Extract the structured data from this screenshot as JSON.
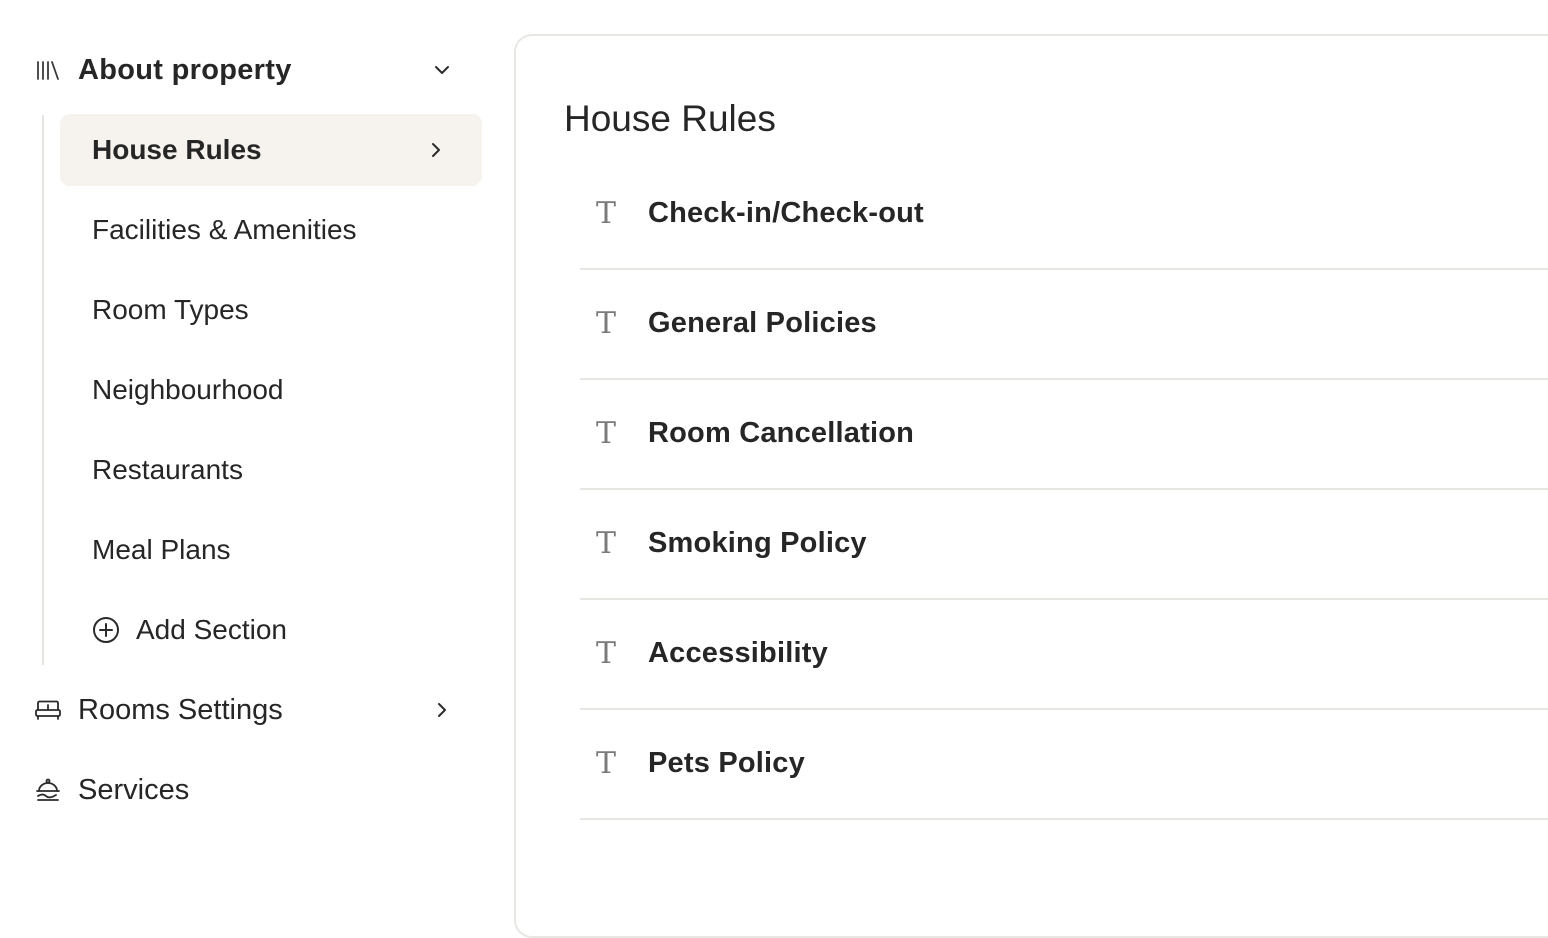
{
  "sidebar": {
    "group": {
      "label": "About property",
      "icon": "library-icon",
      "expanded": true
    },
    "sub_items": [
      {
        "label": "House Rules",
        "active": true
      },
      {
        "label": "Facilities & Amenities",
        "active": false
      },
      {
        "label": "Room Types",
        "active": false
      },
      {
        "label": "Neighbourhood",
        "active": false
      },
      {
        "label": "Restaurants",
        "active": false
      },
      {
        "label": "Meal Plans",
        "active": false
      }
    ],
    "add_section_label": "Add Section",
    "rooms_settings_label": "Rooms Settings",
    "services_label": "Services"
  },
  "main": {
    "title": "House Rules",
    "rules": [
      {
        "label": "Check-in/Check-out",
        "icon_glyph": "T"
      },
      {
        "label": "General Policies",
        "icon_glyph": "T"
      },
      {
        "label": "Room Cancellation",
        "icon_glyph": "T"
      },
      {
        "label": "Smoking Policy",
        "icon_glyph": "T"
      },
      {
        "label": "Accessibility",
        "icon_glyph": "T"
      },
      {
        "label": "Pets Policy",
        "icon_glyph": "T"
      }
    ]
  },
  "colors": {
    "active_bg": "#f6f3ee",
    "divider": "#e8e6e2",
    "text": "#262626",
    "icon": "#7a7a7a"
  }
}
